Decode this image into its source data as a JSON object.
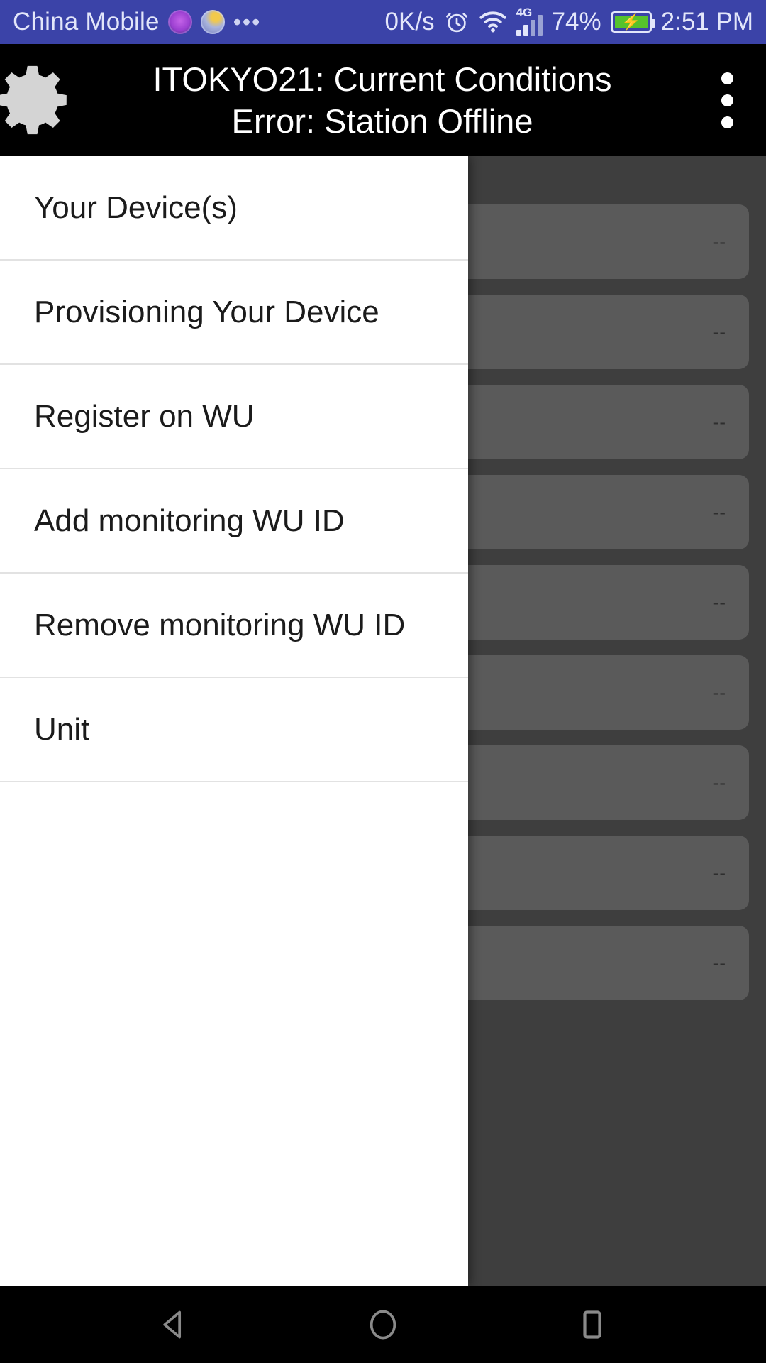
{
  "statusbar": {
    "carrier": "China Mobile",
    "ellipsis": "•••",
    "network_speed": "0K/s",
    "network_type": "4G",
    "battery_percent": "74%",
    "time": "2:51 PM",
    "icons": {
      "app_badge_purple": "app-badge-purple-icon",
      "app_badge_light": "app-badge-light-icon",
      "alarm": "alarm-clock-icon",
      "wifi": "wifi-icon",
      "signal": "signal-bars-icon",
      "battery": "battery-charging-icon"
    },
    "bg_color": "#3b43a8",
    "text_color": "#e3e6fa",
    "battery_fill_color": "#56c22c"
  },
  "appbar": {
    "gear_icon": "gear-icon",
    "title_line1": "ITOKYO21: Current Conditions",
    "title_line2": "Error: Station Offline",
    "overflow_icon": "overflow-menu-icon",
    "bg_color": "#000000",
    "text_color": "#ffffff"
  },
  "drawer": {
    "items": [
      {
        "label": "Your Device(s)"
      },
      {
        "label": "Provisioning Your Device"
      },
      {
        "label": "Register on WU"
      },
      {
        "label": "Add monitoring WU ID"
      },
      {
        "label": "Remove monitoring WU ID"
      },
      {
        "label": "Unit"
      }
    ],
    "bg_color": "#ffffff",
    "divider_color": "#e2e2e2"
  },
  "content": {
    "scrim_color": "#3e3e3e",
    "card_color": "#5a5a5a",
    "cards": [
      {
        "value": "--"
      },
      {
        "value": "--"
      },
      {
        "value": "--"
      },
      {
        "value": "--"
      },
      {
        "value": "--"
      },
      {
        "value": "--"
      },
      {
        "value": "--"
      },
      {
        "value": "--"
      },
      {
        "value": "--"
      }
    ]
  },
  "navbar": {
    "back": "back-triangle-icon",
    "home": "home-circle-icon",
    "recents": "recents-square-icon",
    "icon_color": "#8a8a8a"
  }
}
